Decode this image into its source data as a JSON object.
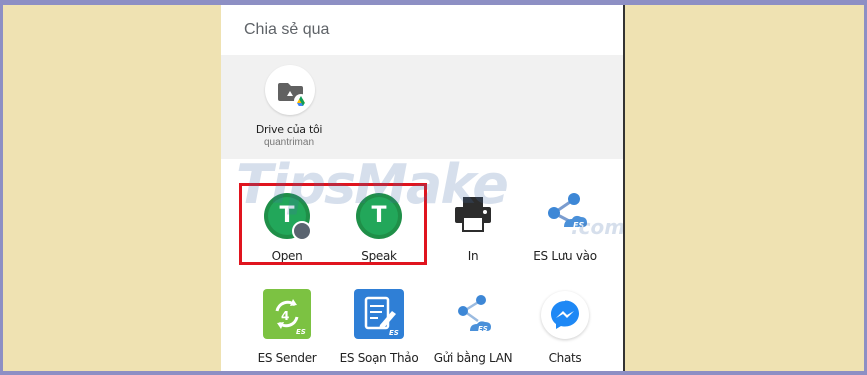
{
  "share_sheet": {
    "title": "Chia sẻ qua"
  },
  "drive_target": {
    "label": "Drive của tôi",
    "account": "quantriman"
  },
  "apps": [
    {
      "label": "Open",
      "icon": "talk-t-icon"
    },
    {
      "label": "Speak",
      "icon": "talk-t-icon"
    },
    {
      "label": "In",
      "icon": "printer-icon"
    },
    {
      "label": "ES Lưu vào",
      "icon": "es-share-icon"
    },
    {
      "label": "ES Sender",
      "icon": "es-sender-icon"
    },
    {
      "label": "ES Soạn Thảo",
      "icon": "es-editor-icon"
    },
    {
      "label": "Gửi bằng LAN",
      "icon": "share-lan-icon"
    },
    {
      "label": "Chats",
      "icon": "messenger-icon"
    }
  ],
  "watermark": {
    "text": "TipsMake",
    "suffix": ".com"
  },
  "colors": {
    "background": "#efe2b2",
    "frame_border": "#8d8fc4",
    "highlight": "#e0141e",
    "talk_green": "#22a75a",
    "es_green": "#7cc242",
    "es_blue": "#2f7fd6",
    "messenger_blue": "#1e88f5"
  }
}
